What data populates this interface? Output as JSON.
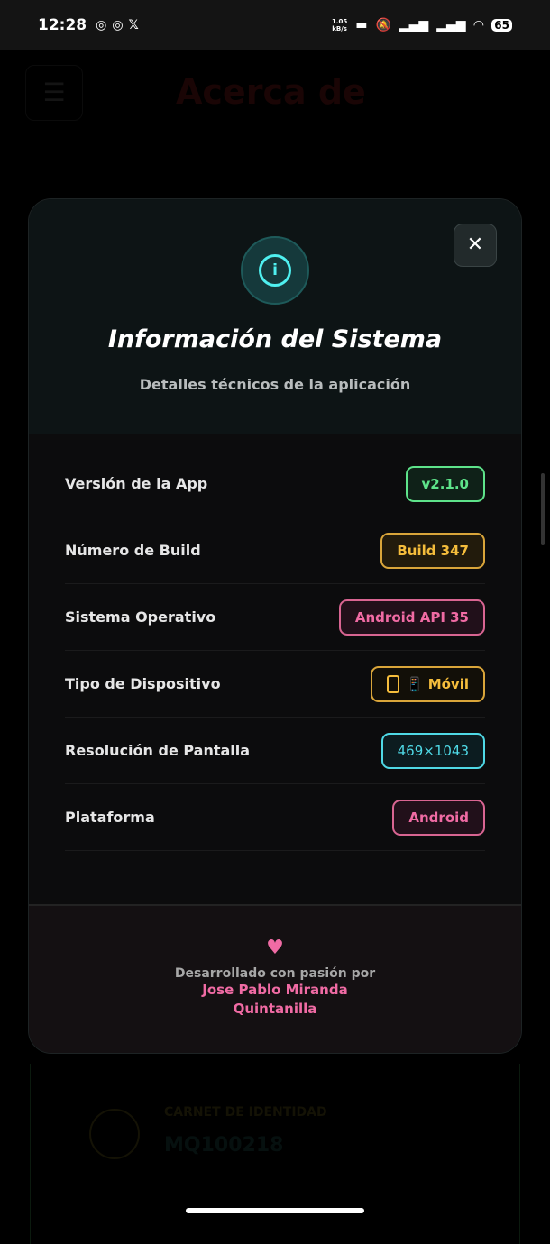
{
  "status_bar": {
    "time": "12:28",
    "notification_icons": "instagram-icon instagram-icon x-icon",
    "net_speed_value": "1.05",
    "net_speed_unit": "kB/s",
    "battery": "65"
  },
  "background": {
    "page_title": "Acerca de",
    "carnet_label": "CARNET DE IDENTIDAD",
    "carnet_value": "MQ100218"
  },
  "modal": {
    "title": "Información del Sistema",
    "subtitle": "Detalles técnicos de la aplicación",
    "close_label": "✕",
    "rows": [
      {
        "label": "Versión de la App",
        "value": "v2.1.0",
        "color": "#5ee38a"
      },
      {
        "label": "Número de Build",
        "value": "Build 347",
        "color": "#f5bd3c"
      },
      {
        "label": "Sistema Operativo",
        "value": "Android API 35",
        "color": "#f06ba4"
      },
      {
        "label": "Tipo de Dispositivo",
        "value": "📱 Móvil",
        "color": "#f5bd3c"
      },
      {
        "label": "Resolución de Pantalla",
        "value": "469×1043",
        "color": "#4fd9e6"
      },
      {
        "label": "Plataforma",
        "value": "Android",
        "color": "#f06ba4"
      }
    ],
    "footer": {
      "text": "Desarrollado con pasión por",
      "name_line1": "Jose Pablo Miranda",
      "name_line2": "Quintanilla"
    }
  }
}
